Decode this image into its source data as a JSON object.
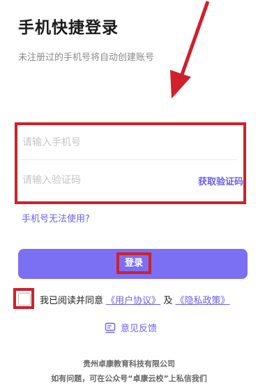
{
  "page": {
    "title": "手机快捷登录",
    "subtitle": "未注册过的手机号将自动创建账号"
  },
  "form": {
    "phone_placeholder": "请输入手机号",
    "phone_value": "",
    "code_placeholder": "请输入验证码",
    "code_value": "",
    "get_code_label": "获取验证码"
  },
  "phone_unusable_label": "手机号无法使用?",
  "login_button_label": "登录",
  "agreement": {
    "checked": false,
    "prefix": "我已阅读并同意",
    "user_agreement": "《用户协议》",
    "conjunction": "及",
    "privacy_policy": "《隐私政策》"
  },
  "feedback": {
    "icon": "feedback-icon",
    "label": "意见反馈"
  },
  "footer": {
    "company": "贵州卓康教育科技有限公司",
    "contact": "如有问题，可在公众号“卓康云校”上私信我们"
  },
  "colors": {
    "accent": "#6c5ef0",
    "button": "#7b70f3",
    "highlight": "#d0202c"
  }
}
